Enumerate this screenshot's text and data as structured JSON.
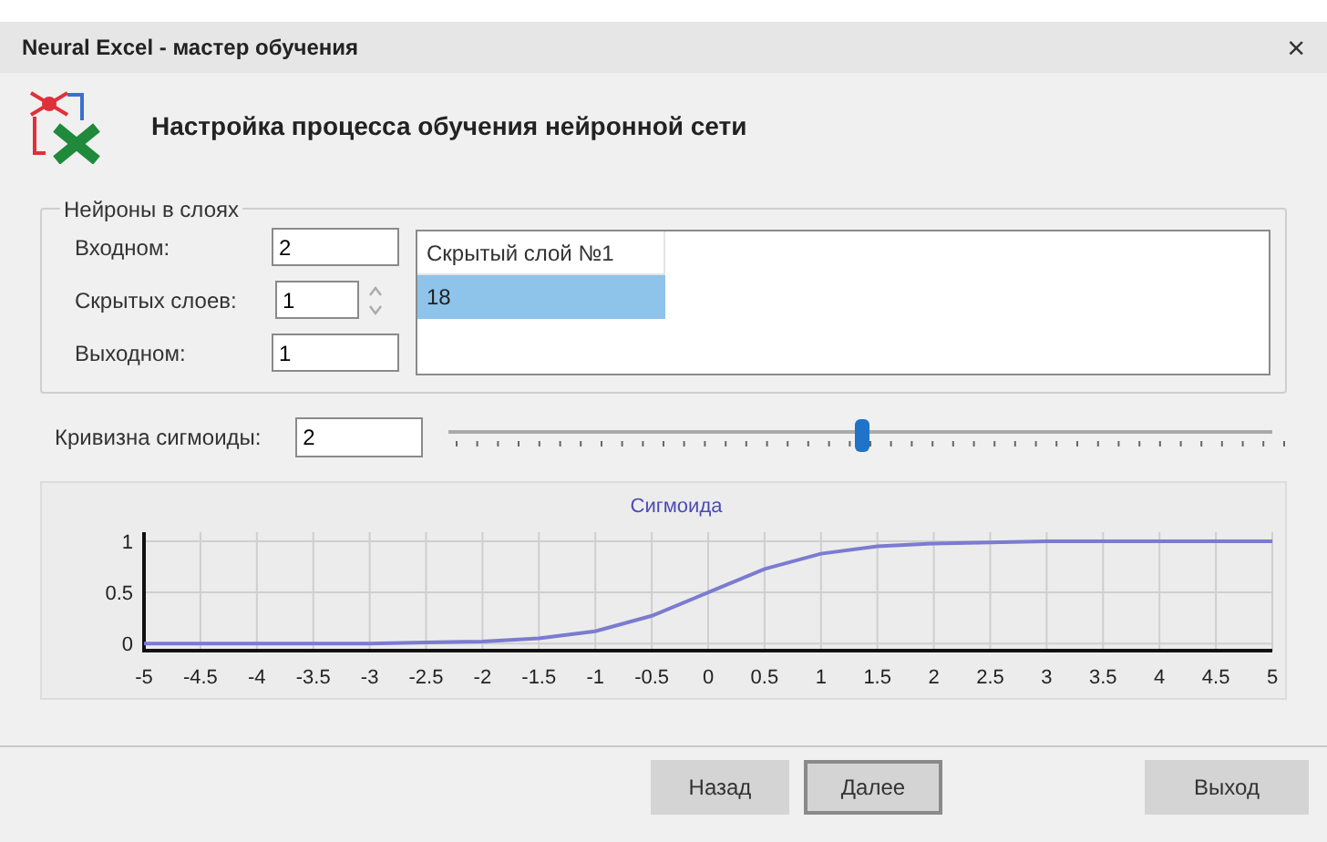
{
  "window": {
    "title": "Neural Excel - мастер обучения",
    "close": "×"
  },
  "header": {
    "title": "Настройка процесса обучения нейронной сети"
  },
  "neurons": {
    "legend": "Нейроны в слоях",
    "fields": [
      {
        "label": "Входном:",
        "value": "2",
        "kind": "text"
      },
      {
        "label": "Скрытых слоев:",
        "value": "1",
        "kind": "spin"
      },
      {
        "label": "Выходном:",
        "value": "1",
        "kind": "text"
      }
    ],
    "layers_table": {
      "columns": [
        "Скрытый слой №1"
      ],
      "rows": [
        {
          "cells": [
            "18"
          ],
          "selected": true
        }
      ]
    }
  },
  "curvature": {
    "label": "Кривизна сигмоиды:",
    "value": "2",
    "slider": {
      "level": 0.49
    }
  },
  "chart": {
    "chart_data": {
      "type": "line",
      "title": "Сигмоида",
      "x": [
        -5,
        -4.5,
        -4,
        -3.5,
        -3,
        -2.5,
        -2,
        -1.5,
        -1,
        -0.5,
        0,
        0.5,
        1,
        1.5,
        2,
        2.5,
        3,
        3.5,
        4,
        4.5,
        5
      ],
      "series": [
        {
          "color": "#7b7bd0",
          "values": [
            0,
            0,
            0,
            0,
            0,
            0.01,
            0.02,
            0.05,
            0.12,
            0.27,
            0.5,
            0.73,
            0.88,
            0.95,
            0.98,
            0.99,
            1,
            1,
            1,
            1,
            1
          ]
        }
      ],
      "grid": true,
      "xlim": [
        -5,
        5
      ],
      "ylim": [
        -0.07,
        1.09
      ],
      "xticks": [
        -5,
        -4.5,
        -4,
        -3.5,
        -3,
        -2.5,
        -2,
        -1.5,
        -1,
        -0.5,
        0,
        0.5,
        1,
        1.5,
        2,
        2.5,
        3,
        3.5,
        4,
        4.5,
        5
      ],
      "yticks": [
        0,
        0.5,
        1
      ]
    }
  },
  "buttons": [
    {
      "label": "Назад",
      "default": false
    },
    {
      "label": "Далее",
      "default": true
    },
    {
      "label": "Выход",
      "default": false
    }
  ]
}
